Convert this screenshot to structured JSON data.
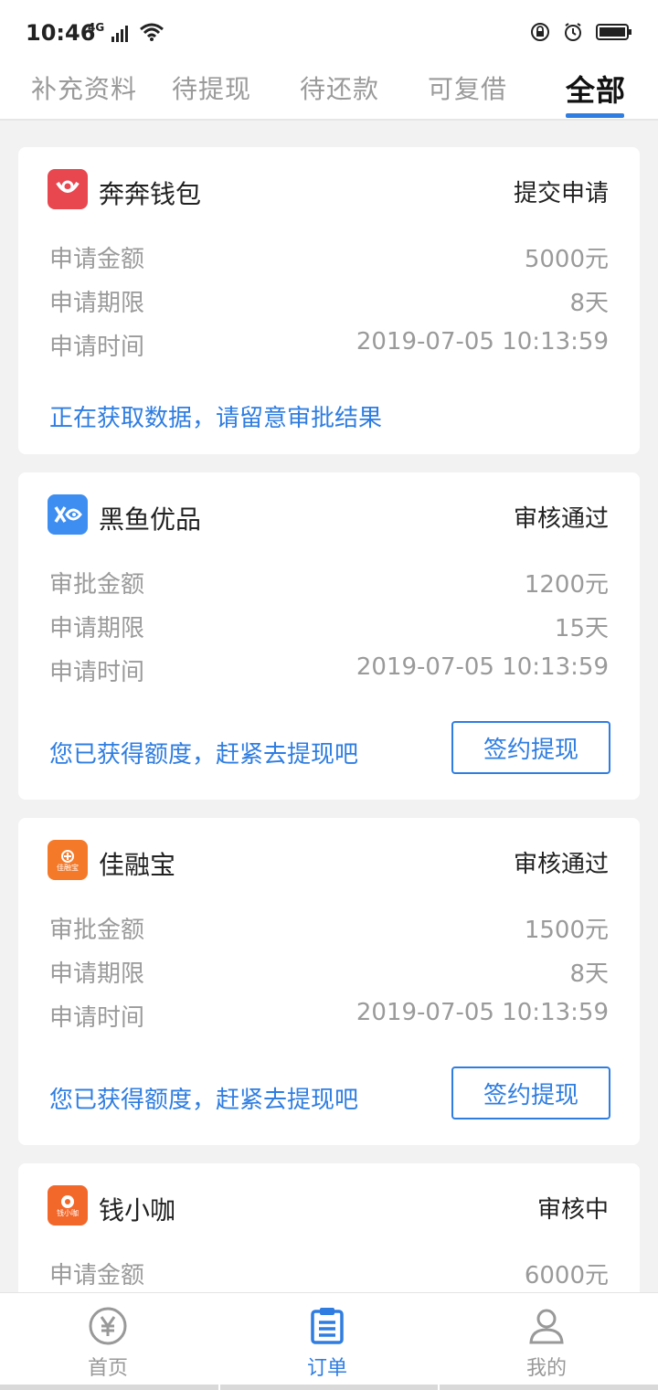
{
  "status_bar": {
    "time": "10:46",
    "network": "4G"
  },
  "tabs": [
    {
      "label": "补充资料"
    },
    {
      "label": "待提现"
    },
    {
      "label": "待还款"
    },
    {
      "label": "可复借"
    },
    {
      "label": "全部",
      "active": true
    }
  ],
  "cards": [
    {
      "name": "奔奔钱包",
      "status": "提交申请",
      "rows": [
        {
          "label": "申请金额",
          "value": "5000元"
        },
        {
          "label": "申请期限",
          "value": "8天"
        },
        {
          "label": "申请时间",
          "value": "2019-07-05 10:13:59"
        }
      ],
      "note": "正在获取数据，请留意审批结果"
    },
    {
      "name": "黑鱼优品",
      "status": "审核通过",
      "rows": [
        {
          "label": "审批金额",
          "value": "1200元"
        },
        {
          "label": "申请期限",
          "value": "15天"
        },
        {
          "label": "申请时间",
          "value": "2019-07-05 10:13:59"
        }
      ],
      "note": "您已获得额度，赶紧去提现吧",
      "button": "签约提现"
    },
    {
      "name": "佳融宝",
      "status": "审核通过",
      "logo_text": "佳融宝",
      "rows": [
        {
          "label": "审批金额",
          "value": "1500元"
        },
        {
          "label": "申请期限",
          "value": "8天"
        },
        {
          "label": "申请时间",
          "value": "2019-07-05 10:13:59"
        }
      ],
      "note": "您已获得额度，赶紧去提现吧",
      "button": "签约提现"
    },
    {
      "name": "钱小咖",
      "status": "审核中",
      "logo_text": "钱小咖",
      "rows": [
        {
          "label": "申请金额",
          "value": "6000元"
        }
      ]
    }
  ],
  "bottom_nav": [
    {
      "label": "首页",
      "icon": "yen-coin-icon"
    },
    {
      "label": "订单",
      "icon": "order-list-icon",
      "active": true
    },
    {
      "label": "我的",
      "icon": "user-icon"
    }
  ],
  "colors": {
    "accent": "#2f7de1",
    "logo_benben": "#e8474f",
    "logo_heiyu": "#3d8ef0",
    "logo_jiarongbao": "#f47a2a",
    "logo_qianxiaoka": "#f2672a"
  }
}
